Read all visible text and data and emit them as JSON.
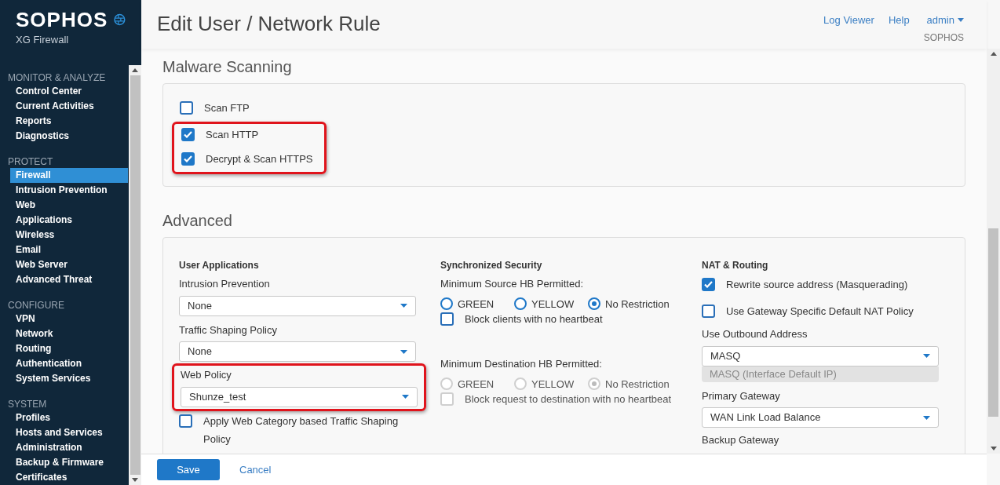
{
  "brand": {
    "name": "SOPHOS",
    "product": "XG Firewall"
  },
  "nav": [
    {
      "heading": "MONITOR & ANALYZE",
      "items": [
        {
          "label": "Control Center",
          "selected": false
        },
        {
          "label": "Current Activities",
          "selected": false
        },
        {
          "label": "Reports",
          "selected": false
        },
        {
          "label": "Diagnostics",
          "selected": false
        }
      ]
    },
    {
      "heading": "PROTECT",
      "items": [
        {
          "label": "Firewall",
          "selected": true
        },
        {
          "label": "Intrusion Prevention",
          "selected": false
        },
        {
          "label": "Web",
          "selected": false
        },
        {
          "label": "Applications",
          "selected": false
        },
        {
          "label": "Wireless",
          "selected": false
        },
        {
          "label": "Email",
          "selected": false
        },
        {
          "label": "Web Server",
          "selected": false
        },
        {
          "label": "Advanced Threat",
          "selected": false
        }
      ]
    },
    {
      "heading": "CONFIGURE",
      "items": [
        {
          "label": "VPN",
          "selected": false
        },
        {
          "label": "Network",
          "selected": false
        },
        {
          "label": "Routing",
          "selected": false
        },
        {
          "label": "Authentication",
          "selected": false
        },
        {
          "label": "System Services",
          "selected": false
        }
      ]
    },
    {
      "heading": "SYSTEM",
      "items": [
        {
          "label": "Profiles",
          "selected": false
        },
        {
          "label": "Hosts and Services",
          "selected": false
        },
        {
          "label": "Administration",
          "selected": false
        },
        {
          "label": "Backup & Firmware",
          "selected": false
        },
        {
          "label": "Certificates",
          "selected": false
        }
      ]
    }
  ],
  "header": {
    "title": "Edit User / Network Rule",
    "links": [
      "Log Viewer",
      "Help"
    ],
    "user": "admin",
    "user_org": "SOPHOS"
  },
  "malware": {
    "title": "Malware Scanning",
    "options": [
      {
        "label": "Scan FTP",
        "checked": false,
        "highlighted": false
      },
      {
        "label": "Scan HTTP",
        "checked": true,
        "highlighted": true
      },
      {
        "label": "Decrypt & Scan HTTPS",
        "checked": true,
        "highlighted": true
      }
    ]
  },
  "advanced": {
    "title": "Advanced",
    "columns": [
      [
        {
          "kind": "heading",
          "text": "User Applications"
        },
        {
          "kind": "field",
          "label": "Intrusion Prevention",
          "value": "None",
          "highlighted": false
        },
        {
          "kind": "field",
          "label": "Traffic Shaping Policy",
          "value": "None",
          "highlighted": false
        },
        {
          "kind": "field",
          "label": "Web Policy",
          "value": "Shunze_test",
          "highlighted": true
        },
        {
          "kind": "checkbox",
          "label": "Apply Web Category based Traffic Shaping Policy",
          "checked": false,
          "disabled": false
        }
      ],
      [
        {
          "kind": "heading",
          "text": "Synchronized Security"
        },
        {
          "kind": "label",
          "text": "Minimum Source HB Permitted:"
        },
        {
          "kind": "radios",
          "disabled": false,
          "options": [
            {
              "label": "GREEN",
              "selected": false
            },
            {
              "label": "YELLOW",
              "selected": false
            },
            {
              "label": "No Restriction",
              "selected": true
            }
          ]
        },
        {
          "kind": "checkbox",
          "label": "Block clients with no heartbeat",
          "checked": false,
          "disabled": false
        },
        {
          "kind": "label",
          "text": "Minimum Destination HB Permitted:"
        },
        {
          "kind": "radios",
          "disabled": true,
          "options": [
            {
              "label": "GREEN",
              "selected": false
            },
            {
              "label": "YELLOW",
              "selected": false
            },
            {
              "label": "No Restriction",
              "selected": true
            }
          ]
        },
        {
          "kind": "checkbox",
          "label": "Block request to destination with no heartbeat",
          "checked": false,
          "disabled": true
        }
      ],
      [
        {
          "kind": "heading",
          "text": "NAT & Routing"
        },
        {
          "kind": "checkbox",
          "label": "Rewrite source address (Masquerading)",
          "checked": true,
          "disabled": false
        },
        {
          "kind": "checkbox",
          "label": "Use Gateway Specific Default NAT Policy",
          "checked": false,
          "disabled": false
        },
        {
          "kind": "field",
          "label": "Use Outbound Address",
          "value": "MASQ",
          "note": "MASQ (Interface Default IP)",
          "highlighted": false
        },
        {
          "kind": "field",
          "label": "Primary Gateway",
          "value": "WAN Link Load Balance",
          "highlighted": false
        },
        {
          "kind": "label",
          "text": "Backup Gateway"
        }
      ]
    ]
  },
  "footer": {
    "save": "Save",
    "cancel": "Cancel"
  }
}
